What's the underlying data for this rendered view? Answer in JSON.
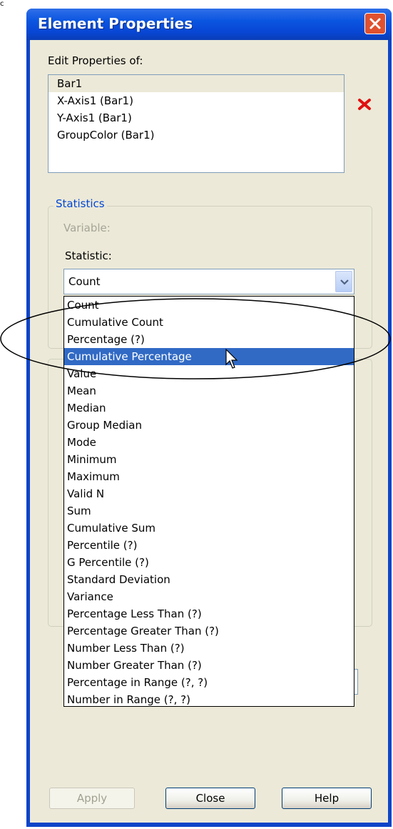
{
  "corner_text": "c",
  "window": {
    "title": "Element Properties"
  },
  "edit_properties": {
    "label": "Edit Properties of:",
    "items": [
      "Bar1",
      "X-Axis1 (Bar1)",
      "Y-Axis1 (Bar1)",
      "GroupColor (Bar1)"
    ],
    "selected": "Bar1"
  },
  "statistics": {
    "group_title": "Statistics",
    "variable_label": "Variable:",
    "statistic_label": "Statistic:",
    "selected_value": "Count"
  },
  "dropdown": {
    "options": [
      "Count",
      "Cumulative Count",
      "Percentage (?)",
      "Cumulative Percentage",
      "Value",
      "Mean",
      "Median",
      "Group Median",
      "Mode",
      "Minimum",
      "Maximum",
      "Valid N",
      "Sum",
      "Cumulative Sum",
      "Percentile (?)",
      "G Percentile (?)",
      "Standard Deviation",
      "Variance",
      "Percentage Less Than (?)",
      "Percentage Greater Than (?)",
      "Number Less Than (?)",
      "Number Greater Than (?)",
      "Percentage in Range (?, ?)",
      "Number in Range (?, ?)"
    ],
    "highlighted": "Cumulative Percentage"
  },
  "buttons": {
    "apply": "Apply",
    "close": "Close",
    "help": "Help"
  },
  "colors": {
    "title_bar": "#0a55e0",
    "highlight": "#316ac5",
    "group_title": "#0046d5",
    "delete_icon": "#e01010"
  },
  "icons": {
    "close": "close-icon",
    "delete": "delete-icon",
    "dropdown_arrow": "chevron-down-icon",
    "cursor": "mouse-pointer-icon"
  }
}
